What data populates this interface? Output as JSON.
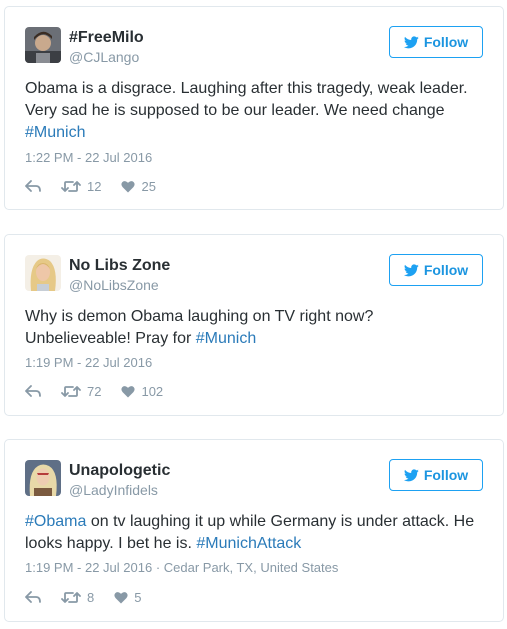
{
  "tweets": [
    {
      "name": "#FreeMilo",
      "handle": "@CJLango",
      "follow_label": "Follow",
      "text_line1": "Obama is a disgrace. Laughing after this tragedy, weak leader.",
      "text_line2": "Very sad he is supposed to be our leader. We need change",
      "text_line3_tag": "#Munich",
      "timestamp": "1:22 PM - 22 Jul 2016",
      "retweets": "12",
      "likes": "25"
    },
    {
      "name": "No Libs Zone",
      "handle": "@NoLibsZone",
      "follow_label": "Follow",
      "text_line1": "Why is demon Obama laughing on TV right now?",
      "text_line2_plain": "Unbelieveable! Pray for ",
      "text_line2_tag": "#Munich",
      "timestamp": "1:19 PM - 22 Jul 2016",
      "retweets": "72",
      "likes": "102"
    },
    {
      "name": "Unapologetic",
      "handle": "@LadyInfidels",
      "follow_label": "Follow",
      "text_line1_tag": "#Obama",
      "text_line1_plain": " on tv laughing it up while Germany is under attack. He",
      "text_line2_plain": "looks happy. I bet he is. ",
      "text_line2_tag": "#MunichAttack",
      "timestamp": "1:19 PM - 22 Jul 2016",
      "location": " · Cedar Park, TX, United States",
      "retweets": "8",
      "likes": "5"
    }
  ],
  "colors": {
    "link": "#2b7bb9",
    "follow_blue": "#1da1f2",
    "muted": "#8899a6",
    "text": "#292f33",
    "border": "#e1e8ed"
  },
  "icons": [
    "twitter-bird-icon",
    "reply-icon",
    "retweet-icon",
    "heart-icon"
  ]
}
